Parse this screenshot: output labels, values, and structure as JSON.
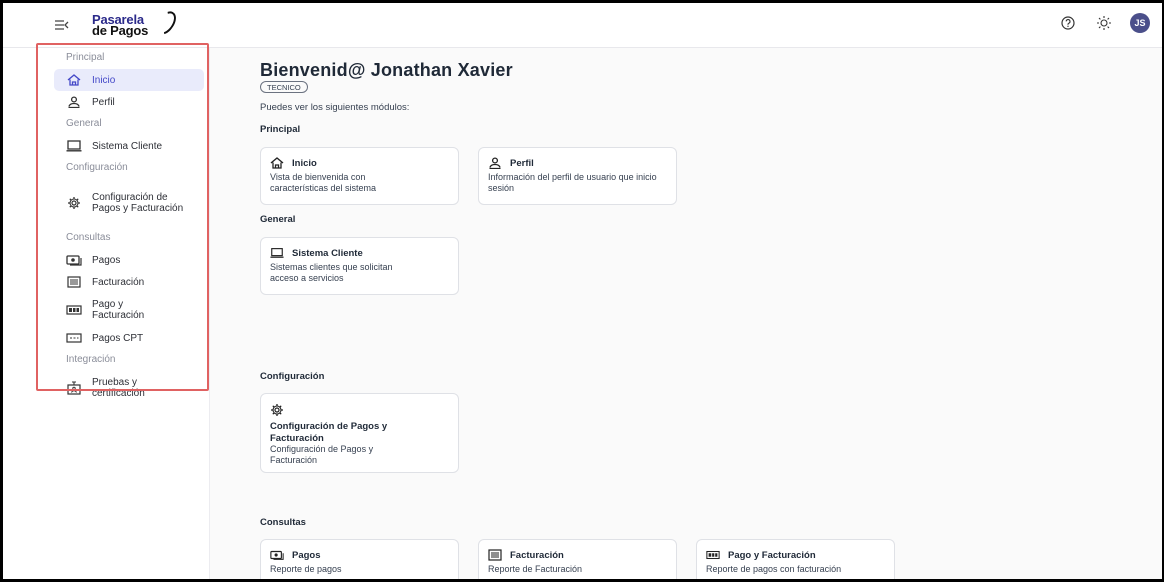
{
  "header": {
    "logo_line1": "Pasarela",
    "logo_line2": "de Pagos",
    "avatar_initials": "JS",
    "icons": [
      "menu-collapse-icon",
      "help-icon",
      "theme-sun-icon"
    ]
  },
  "sidebar": {
    "sections": [
      {
        "title": "Principal",
        "items": [
          {
            "label": "Inicio",
            "icon": "home-icon",
            "active": true
          },
          {
            "label": "Perfil",
            "icon": "user-icon",
            "active": false
          }
        ]
      },
      {
        "title": "General",
        "items": [
          {
            "label": "Sistema Cliente",
            "icon": "laptop-icon",
            "active": false
          }
        ]
      },
      {
        "title": "Configuración",
        "items": [
          {
            "label": "Configuración de Pagos y Facturación",
            "icon": "gear-icon",
            "active": false
          }
        ]
      },
      {
        "title": "Consultas",
        "items": [
          {
            "label": "Pagos",
            "icon": "cash-icon",
            "active": false
          },
          {
            "label": "Facturación",
            "icon": "invoice-icon",
            "active": false
          },
          {
            "label": "Pago y Facturación",
            "icon": "register-icon",
            "active": false
          },
          {
            "label": "Pagos CPT",
            "icon": "card-icon",
            "active": false
          }
        ]
      },
      {
        "title": "Integración",
        "items": [
          {
            "label": "Pruebas y certificación",
            "icon": "certificate-icon",
            "active": false
          }
        ]
      }
    ]
  },
  "main": {
    "welcome": "Bienvenid@ Jonathan Xavier",
    "role": "TECNICO",
    "subtitle": "Puedes ver los siguientes módulos:",
    "categories": [
      {
        "title": "Principal",
        "cards": [
          {
            "title": "Inicio",
            "description": "Vista de bienvenida con características del sistema",
            "icon": "home-icon"
          },
          {
            "title": "Perfil",
            "description": "Información del perfil de usuario que inicio sesión",
            "icon": "user-icon"
          }
        ]
      },
      {
        "title": "General",
        "cards": [
          {
            "title": "Sistema Cliente",
            "description": "Sistemas clientes que solicitan acceso a servicios",
            "icon": "laptop-icon"
          }
        ]
      },
      {
        "title": "Configuración",
        "cards": [
          {
            "title": "Configuración de Pagos y Facturación",
            "description": "Configuración de Pagos y Facturación",
            "icon": "gear-icon"
          }
        ]
      },
      {
        "title": "Consultas",
        "cards": [
          {
            "title": "Pagos",
            "description": "Reporte de pagos",
            "icon": "cash-icon"
          },
          {
            "title": "Facturación",
            "description": "Reporte de Facturación",
            "icon": "invoice-icon"
          },
          {
            "title": "Pago y Facturación",
            "description": "Reporte de pagos con facturación",
            "icon": "register-icon"
          }
        ]
      }
    ]
  },
  "colors": {
    "accent": "#4448c8",
    "active_bg": "#e9ebfb",
    "highlight_border": "#e06262"
  }
}
